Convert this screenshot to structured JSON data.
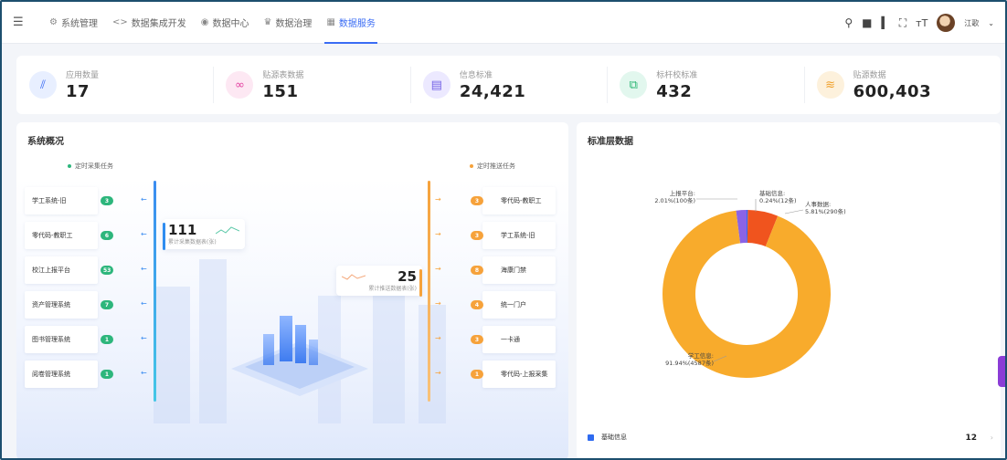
{
  "nav": {
    "menu_icon": "menu-fold-icon",
    "items": [
      {
        "label": "系统管理",
        "icon": "⚙"
      },
      {
        "label": "数据集成开发",
        "icon": "<>"
      },
      {
        "label": "数据中心",
        "icon": "◉"
      },
      {
        "label": "数据治理",
        "icon": "♛"
      },
      {
        "label": "数据服务",
        "icon": "▦"
      }
    ],
    "active_index": 4
  },
  "toolbar": {
    "icons": [
      "search-icon",
      "message-icon",
      "chart-icon",
      "fullscreen-icon",
      "font-size-icon"
    ],
    "username": "江歌"
  },
  "stats": [
    {
      "label": "应用数量",
      "value": "17",
      "color": "#e8efff",
      "fg": "#3a6cf4",
      "icon": "⫽"
    },
    {
      "label": "贴源表数据",
      "value": "151",
      "color": "#fde8f3",
      "fg": "#e33fa0",
      "icon": "∞"
    },
    {
      "label": "信息标准",
      "value": "24,421",
      "color": "#ece9ff",
      "fg": "#7462e6",
      "icon": "▤"
    },
    {
      "label": "标杆校标准",
      "value": "432",
      "color": "#e2f7ee",
      "fg": "#2bb673",
      "icon": "⧉"
    },
    {
      "label": "贴源数据",
      "value": "600,403",
      "color": "#fdf1dc",
      "fg": "#f0a12c",
      "icon": "≋"
    }
  ],
  "overview": {
    "title": "系统概况",
    "left_legend": "定时采集任务",
    "right_legend": "定时推送任务",
    "left_total": "111",
    "left_total_desc": "累计采集数据表(张)",
    "right_total": "25",
    "right_total_desc": "累计推送数据表(张)",
    "left_items": [
      {
        "name": "学工系统-旧",
        "count": "3"
      },
      {
        "name": "零代码-教职工",
        "count": "6"
      },
      {
        "name": "校江上报平台",
        "count": "53"
      },
      {
        "name": "资产管理系统",
        "count": "7"
      },
      {
        "name": "图书管理系统",
        "count": "1"
      },
      {
        "name": "阅卷管理系统",
        "count": "1"
      }
    ],
    "right_items": [
      {
        "name": "零代码-教职工",
        "count": "3"
      },
      {
        "name": "学工系统-旧",
        "count": "3"
      },
      {
        "name": "海康门禁",
        "count": "8"
      },
      {
        "name": "统一门户",
        "count": "4"
      },
      {
        "name": "一卡通",
        "count": "3"
      },
      {
        "name": "零代码-上报采集",
        "count": "1"
      }
    ],
    "left_color": "#2db67c",
    "right_color": "#f6a23b"
  },
  "standard": {
    "title": "标准层数据",
    "legend_label": "基础信息",
    "legend_count": "12"
  },
  "chart_data": {
    "type": "pie",
    "title": "标准层数据",
    "slices": [
      {
        "name": "学工信息",
        "value": 4587,
        "percent": 91.94,
        "label": "学工信息:\n91.94%(4587条)",
        "color": "#f8ab2c"
      },
      {
        "name": "上报平台",
        "value": 100,
        "percent": 2.01,
        "label": "上报平台:\n2.01%(100条)",
        "color": "#8a63e6"
      },
      {
        "name": "基础信息",
        "value": 12,
        "percent": 0.24,
        "label": "基础信息:\n0.24%(12条)",
        "color": "#2f6bf0"
      },
      {
        "name": "人事数据",
        "value": 290,
        "percent": 5.81,
        "label": "人事数据:\n5.81%(290条)",
        "color": "#f0541e"
      }
    ],
    "donut": true,
    "legend": "bottom"
  }
}
